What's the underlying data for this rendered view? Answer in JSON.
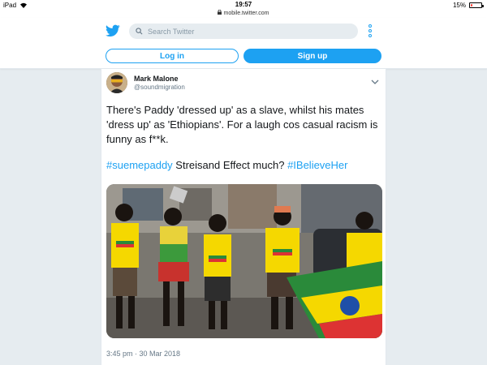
{
  "status_bar": {
    "device": "iPad",
    "time": "19:57",
    "battery": "15%",
    "battery_fraction": 0.15,
    "battery_color": "#ff3b30"
  },
  "url_bar": {
    "url": "mobile.twitter.com"
  },
  "header": {
    "logo_icon": "twitter-bird-icon",
    "search_placeholder": "Search Twitter",
    "login_label": "Log in",
    "signup_label": "Sign up",
    "accent": "#1da1f2"
  },
  "tweet": {
    "author_name": "Mark Malone",
    "author_handle": "@soundmigration",
    "text": "There's Paddy 'dressed up' as a slave, whilst his mates 'dress up' as 'Ethiopians'. For a laugh cos casual racism is funny as f**k.",
    "hashtag1": "#suemepaddy",
    "middle": " Streisand Effect much? ",
    "hashtag2": "#IBelieveHer",
    "timestamp": "3:45 pm · 30 Mar 2018"
  }
}
